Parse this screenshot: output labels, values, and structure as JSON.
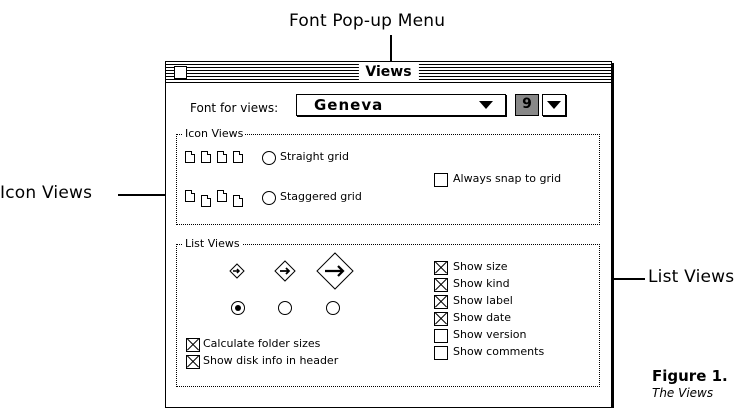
{
  "callouts": {
    "font_popup": "Font Pop-up Menu",
    "icon_views": "Icon Views",
    "list_views": "List Views"
  },
  "window": {
    "title": "Views",
    "font_label": "Font for views:",
    "font_value": "Geneva",
    "size_value": "9"
  },
  "icon_views": {
    "label": "Icon Views",
    "straight_grid": "Straight grid",
    "staggered_grid": "Staggered grid",
    "straight_selected": true,
    "always_snap": "Always snap to grid",
    "always_snap_checked": false
  },
  "list_views": {
    "label": "List Views",
    "icon_size_selected": "small",
    "calc_folder_sizes": "Calculate folder sizes",
    "calc_folder_sizes_checked": true,
    "show_disk_info": "Show disk info in header",
    "show_disk_info_checked": true,
    "options": [
      {
        "label": "Show size",
        "checked": true
      },
      {
        "label": "Show kind",
        "checked": true
      },
      {
        "label": "Show label",
        "checked": true
      },
      {
        "label": "Show date",
        "checked": true
      },
      {
        "label": "Show version",
        "checked": false
      },
      {
        "label": "Show comments",
        "checked": false
      }
    ]
  },
  "figure": {
    "title": "Figure 1.",
    "subtitle": "The Views"
  }
}
